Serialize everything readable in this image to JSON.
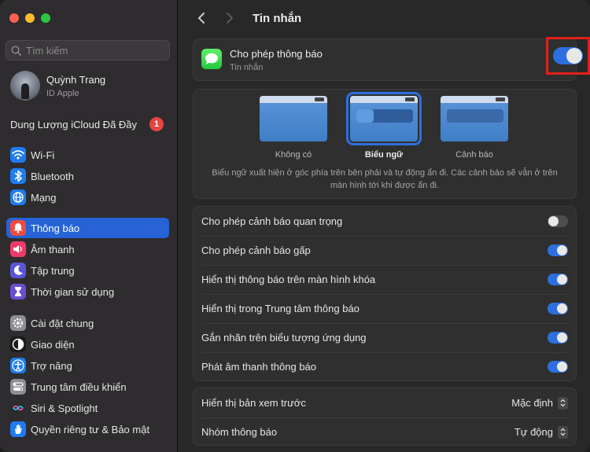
{
  "sidebar": {
    "search_placeholder": "Tìm kiếm",
    "account": {
      "name": "Quỳnh Trang",
      "subtitle": "ID Apple"
    },
    "icloud": {
      "label": "Dung Lượng iCloud Đã Đầy",
      "badge": "1"
    },
    "items": [
      {
        "label": "Wi-Fi",
        "icon": "wifi-icon",
        "color": "#1e7cf2"
      },
      {
        "label": "Bluetooth",
        "icon": "bluetooth-icon",
        "color": "#1e7cf2"
      },
      {
        "label": "Mạng",
        "icon": "globe-icon",
        "color": "#1e7cf2"
      },
      {
        "label": "Thông báo",
        "icon": "bell-icon",
        "color": "#ef4b43",
        "active": true
      },
      {
        "label": "Âm thanh",
        "icon": "speaker-icon",
        "color": "#ef3b6a"
      },
      {
        "label": "Tập trung",
        "icon": "moon-icon",
        "color": "#5b55d9"
      },
      {
        "label": "Thời gian sử dụng",
        "icon": "hourglass-icon",
        "color": "#6a4fd3"
      },
      {
        "label": "Cài đặt chung",
        "icon": "gear-icon",
        "color": "#8e8e93"
      },
      {
        "label": "Giao diện",
        "icon": "appearance-icon",
        "color": "#1b1b1b"
      },
      {
        "label": "Trợ năng",
        "icon": "accessibility-icon",
        "color": "#1e7cf2"
      },
      {
        "label": "Trung tâm điều khiển",
        "icon": "control-center-icon",
        "color": "#8e8e93"
      },
      {
        "label": "Siri & Spotlight",
        "icon": "siri-icon",
        "color": "#a34dd8"
      },
      {
        "label": "Quyền riêng tư & Bảo mật",
        "icon": "hand-icon",
        "color": "#1e7cf2"
      }
    ]
  },
  "header": {
    "title": "Tin nhắn"
  },
  "app": {
    "title": "Cho phép thông báo",
    "subtitle": "Tin nhắn",
    "allow_enabled": true
  },
  "alert_style": {
    "options": [
      {
        "label": "Không có",
        "selected": false
      },
      {
        "label": "Biểu ngữ",
        "selected": true
      },
      {
        "label": "Cảnh báo",
        "selected": false
      }
    ],
    "description": "Biểu ngữ xuất hiện ở góc phía trên bên phải và tự động ẩn đi. Các cảnh báo sẽ vẫn ở trên màn hình tới khi được ẩn đi."
  },
  "settings": [
    {
      "label": "Cho phép cảnh báo quan trọng",
      "on": false
    },
    {
      "label": "Cho phép cảnh báo gấp",
      "on": true
    },
    {
      "label": "Hiển thị thông báo trên màn hình khóa",
      "on": true
    },
    {
      "label": "Hiển thị trong Trung tâm thông báo",
      "on": true
    },
    {
      "label": "Gắn nhãn trên biểu tượng ứng dụng",
      "on": true
    },
    {
      "label": "Phát âm thanh thông báo",
      "on": true
    }
  ],
  "options": [
    {
      "label": "Hiển thị bản xem trước",
      "value": "Mặc định"
    },
    {
      "label": "Nhóm thông báo",
      "value": "Tự động"
    }
  ],
  "colors": {
    "accent": "#2d6fe0",
    "highlight": "#e0211b"
  }
}
